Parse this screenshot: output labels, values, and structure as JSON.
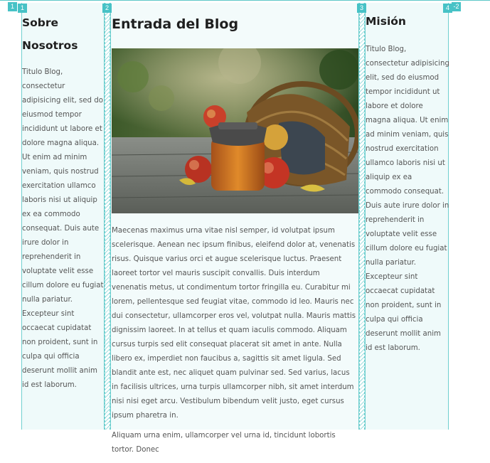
{
  "column_badges": [
    "1",
    "1",
    "2",
    "3",
    "4",
    "-2"
  ],
  "left_column": {
    "title": "Sobre Nosotros",
    "body": "Titulo Blog, consectetur adipisicing elit, sed do eiusmod tempor incididunt ut labore et dolore magna aliqua. Ut enim ad minim veniam, quis nostrud exercitation ullamco laboris nisi ut aliquip ex ea commodo consequat. Duis aute irure dolor in reprehenderit in voluptate velit esse cillum dolore eu fugiat nulla pariatur. Excepteur sint occaecat cupidatat non proident, sunt in culpa qui officia deserunt mollit anim id est laborum."
  },
  "main_column": {
    "title": "Entrada del Blog",
    "image_alt": "Frasco de miel, manzanas y cesta de mimbre",
    "paragraph_1": "Maecenas maximus urna vitae nisl semper, id volutpat ipsum scelerisque. Aenean nec ipsum finibus, eleifend dolor at, venenatis risus. Quisque varius orci et augue scelerisque luctus. Praesent laoreet tortor vel mauris suscipit convallis. Duis interdum venenatis metus, ut condimentum tortor fringilla eu. Curabitur mi lorem, pellentesque sed feugiat vitae, commodo id leo. Mauris nec dui consectetur, ullamcorper eros vel, volutpat nulla. Mauris mattis dignissim laoreet. In at tellus et quam iaculis commodo. Aliquam cursus turpis sed elit consequat placerat sit amet in ante. Nulla libero ex, imperdiet non faucibus a, sagittis sit amet ligula. Sed blandit ante est, nec aliquet quam pulvinar sed. Sed varius, lacus in facilisis ultrices, urna turpis ullamcorper nibh, sit amet interdum nisi nisi eget arcu. Vestibulum bibendum velit justo, eget cursus ipsum pharetra in.",
    "paragraph_2": "Aliquam urna enim, ullamcorper vel urna id, tincidunt lobortis tortor. Donec"
  },
  "right_column": {
    "title": "Misión",
    "body": "Titulo Blog, consectetur adipisicing elit, sed do eiusmod tempor incididunt ut labore et dolore magna aliqua. Ut enim ad minim veniam, quis nostrud exercitation ullamco laboris nisi ut aliquip ex ea commodo consequat. Duis aute irure dolor in reprehenderit in voluptate velit esse cillum dolore eu fugiat nulla pariatur. Excepteur sint occaecat cupidatat non proident, sunt in culpa qui officia deserunt mollit anim id est laborum."
  },
  "colors": {
    "grid_line": "#6fcfcf",
    "column_bg": "#effafa",
    "badge_bg": "#47c2c6",
    "heading": "#1f1f1f",
    "body_text": "#555555"
  }
}
